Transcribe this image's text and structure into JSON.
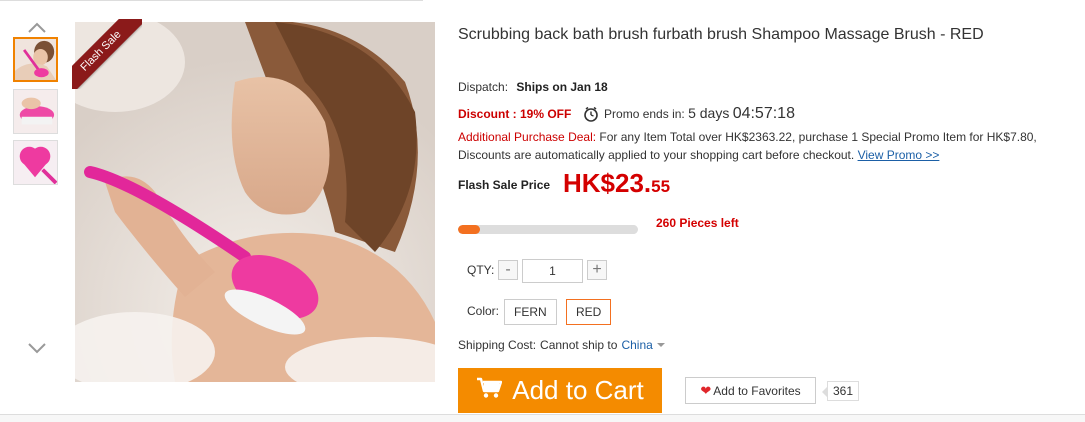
{
  "product": {
    "title": "Scrubbing back bath brush furbath brush Shampoo Massage Brush  -  RED",
    "ribbon": "Flash Sale"
  },
  "gallery": {
    "up_icon": "chevron-up-icon",
    "down_icon": "chevron-down-icon",
    "thumbnails": [
      "thumb-1",
      "thumb-2",
      "thumb-3"
    ],
    "selected_index": 0
  },
  "dispatch": {
    "label": "Dispatch:",
    "value": "Ships on Jan 18"
  },
  "promo": {
    "discount": "Discount : 19% OFF",
    "ends_label": "Promo ends in:",
    "days": "5 days",
    "time": "04:57:18",
    "clock_icon": "clock-icon"
  },
  "deal": {
    "label": "Additional Purchase Deal:",
    "text": " For any Item Total over HK$2363.22, purchase 1 Special Promo Item for HK$7.80, Discounts are automatically applied to your shopping cart before checkout. ",
    "link": "View Promo >>"
  },
  "price": {
    "label": "Flash Sale Price",
    "main": "HK$23.",
    "cents": "55"
  },
  "stock": {
    "sold_fraction": 0.12,
    "pieces_left": "260 Pieces left"
  },
  "quantity": {
    "label": "QTY:",
    "minus": "-",
    "plus": "+",
    "value": "1"
  },
  "color": {
    "label": "Color:",
    "options": [
      "FERN",
      "RED"
    ],
    "selected": "RED"
  },
  "shipping": {
    "label": "Shipping Cost:",
    "value": "Cannot ship to",
    "country": "China"
  },
  "actions": {
    "add_to_cart": "Add to Cart",
    "cart_icon": "cart-icon",
    "add_to_favorites": "Add to Favorites",
    "favorites_count": "361",
    "heart_icon": "heart-icon"
  },
  "colors": {
    "accent_orange": "#f48b00",
    "price_red": "#d40000",
    "ribbon_red": "#8b1a1a",
    "link_blue": "#1b5fa6"
  }
}
